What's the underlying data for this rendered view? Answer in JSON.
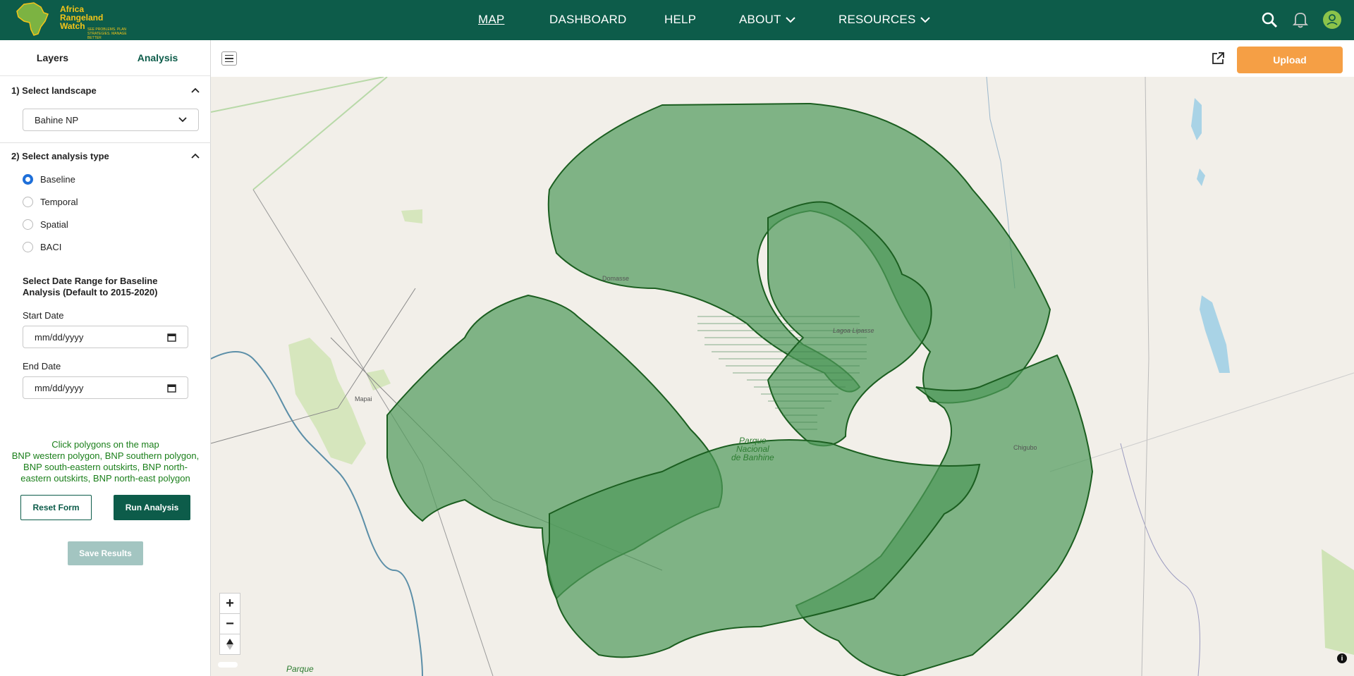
{
  "header": {
    "logo_text_lines": [
      "Africa",
      "Rangeland",
      "Watch"
    ],
    "logo_tagline": "SEE PROBLEMS. PLAN STRATEGIES. MANAGE BETTER",
    "nav": [
      {
        "label": "MAP",
        "active": true
      },
      {
        "label": "DASHBOARD"
      },
      {
        "label": "HELP"
      },
      {
        "label": "ABOUT"
      },
      {
        "label": "RESOURCES"
      }
    ],
    "icons": [
      "search-icon",
      "bell-icon",
      "user-icon"
    ]
  },
  "sidebar": {
    "tabs": [
      {
        "label": "Layers"
      },
      {
        "label": "Analysis",
        "active": true
      }
    ],
    "section1": {
      "title": "1) Select landscape",
      "selected": "Bahine NP"
    },
    "section2": {
      "title": "2) Select analysis type",
      "options": [
        {
          "label": "Baseline",
          "checked": true
        },
        {
          "label": "Temporal"
        },
        {
          "label": "Spatial"
        },
        {
          "label": "BACI"
        }
      ]
    },
    "date_range": {
      "title_line1": "Select Date Range for Baseline",
      "title_line2": "Analysis (Default to 2015-2020)",
      "start_label": "Start Date",
      "start_value": "mm/dd/yyyy",
      "end_label": "End Date",
      "end_value": "mm/dd/yyyy"
    },
    "hint": {
      "line1": "Click polygons on the map",
      "line2": "BNP western polygon, BNP southern polygon,",
      "line3": "BNP south-eastern outskirts, BNP north-",
      "line4": "eastern outskirts, BNP north-east polygon"
    },
    "buttons": {
      "reset": "Reset Form",
      "run": "Run Analysis",
      "save": "Save Results"
    }
  },
  "map_toolbar": {
    "upload_label": "Upload"
  },
  "map": {
    "labels": {
      "domasse": "Domasse",
      "lagoa": "Lagoa Lipasse",
      "mapai": "Mapai",
      "chigubo": "Chigubo",
      "park1": "Parque",
      "park2": "Nacional",
      "park3": "de Banhine",
      "park_bottom": "Parque"
    },
    "controls": {
      "zoom_in": "+",
      "zoom_out": "−"
    },
    "colors": {
      "polygon_fill": "#4e9a5a",
      "polygon_stroke": "#1b5e20",
      "land": "#f2efe9",
      "park": "#d6e6bd",
      "water": "#a9d3e6"
    }
  }
}
